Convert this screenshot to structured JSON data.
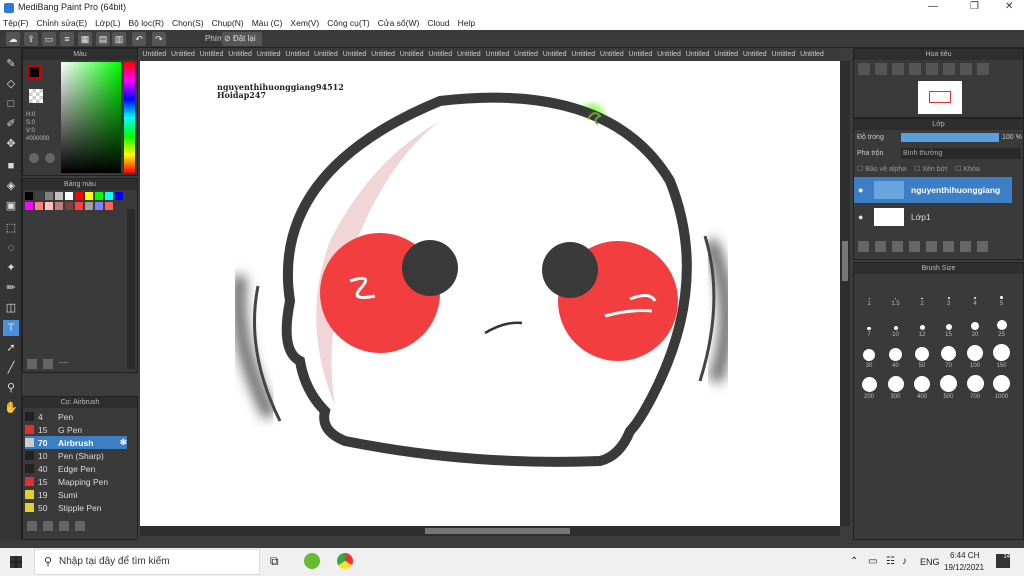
{
  "window": {
    "title": "MediBang Paint Pro (64bit)"
  },
  "menu": [
    "Tệp(F)",
    "Chỉnh sửa(E)",
    "Lớp(L)",
    "Bộ lọc(R)",
    "Chọn(S)",
    "Chụp(N)",
    "Màu (C)",
    "Xem(V)",
    "Công cụ(T)",
    "Cửa sổ(W)",
    "Cloud",
    "Help"
  ],
  "toolbar": {
    "key_label": "Phím",
    "reset_label": "Đặt lại"
  },
  "color_panel": {
    "title": "Màu",
    "h": "H:0",
    "s": "S:0",
    "v": "V:0",
    "hex": "#000000",
    "fg_color": "#000000",
    "bg_color": "#ffffff"
  },
  "palette_panel": {
    "title": "Bảng màu",
    "colors": [
      "#000000",
      "#404040",
      "#808080",
      "#c0c0c0",
      "#ffffff",
      "#ff0000",
      "#ffff00",
      "#00ff00",
      "#00ffff",
      "#0000ff",
      "#ff00ff",
      "#ff8080",
      "#ffc0c0",
      "#c08080",
      "#804040",
      "#ff4040",
      "#a0a0a0",
      "#8080ff",
      "#ff6060"
    ],
    "footer": "----"
  },
  "brush_panel": {
    "title": "Cọ: Airbrush",
    "items": [
      {
        "size": "4",
        "name": "Pen",
        "color": "#222222"
      },
      {
        "size": "15",
        "name": "G Pen",
        "color": "#e03030"
      },
      {
        "size": "70",
        "name": "Airbrush",
        "color": "#cccccc"
      },
      {
        "size": "10",
        "name": "Pen (Sharp)",
        "color": "#222222"
      },
      {
        "size": "40",
        "name": "Edge Pen",
        "color": "#222222"
      },
      {
        "size": "15",
        "name": "Mapping Pen",
        "color": "#e03030"
      },
      {
        "size": "19",
        "name": "Sumi",
        "color": "#e0d030"
      },
      {
        "size": "50",
        "name": "Stipple Pen",
        "color": "#e0d030"
      }
    ]
  },
  "tabs": [
    "Untitled",
    "Untitled",
    "Untitled",
    "Untitled",
    "Untitled",
    "Untitled",
    "Untitled",
    "Untitled",
    "Untitled",
    "Untitled",
    "Untitled",
    "Untitled",
    "Untitled",
    "Untitled",
    "Untitled",
    "Untitled",
    "Untitled",
    "Untitled",
    "Untitled",
    "Untitled",
    "Untitled",
    "Untitled",
    "Untitled",
    "Untitled"
  ],
  "canvas": {
    "text1": "nguyenthihuonggiang94512",
    "text2": "Hoidap247"
  },
  "navigator": {
    "title": "Hoa tiêu"
  },
  "layer_panel": {
    "title": "Lớp",
    "opacity_label": "Độ trong",
    "opacity_value": "100 %",
    "blend_label": "Pha trộn",
    "blend_value": "Bình thường",
    "protect_alpha": "Bảo vệ alpha",
    "clipping": "Xén bớt",
    "lock": "Khóa",
    "layers": [
      "nguyenthihuonggiang",
      "Lớp1"
    ]
  },
  "brush_size": {
    "title": "Brush Size",
    "sizes": [
      "1",
      "1.5",
      "2",
      "3",
      "4",
      "5",
      "7",
      "10",
      "12",
      "15",
      "20",
      "25",
      "30",
      "40",
      "50",
      "70",
      "100",
      "150",
      "200",
      "300",
      "400",
      "500",
      "700",
      "1000"
    ]
  },
  "taskbar": {
    "search_placeholder": "Nhập tại đây để tìm kiếm",
    "time": "6:44 CH",
    "date": "19/12/2021",
    "lang": "ENG",
    "notif": "14"
  }
}
